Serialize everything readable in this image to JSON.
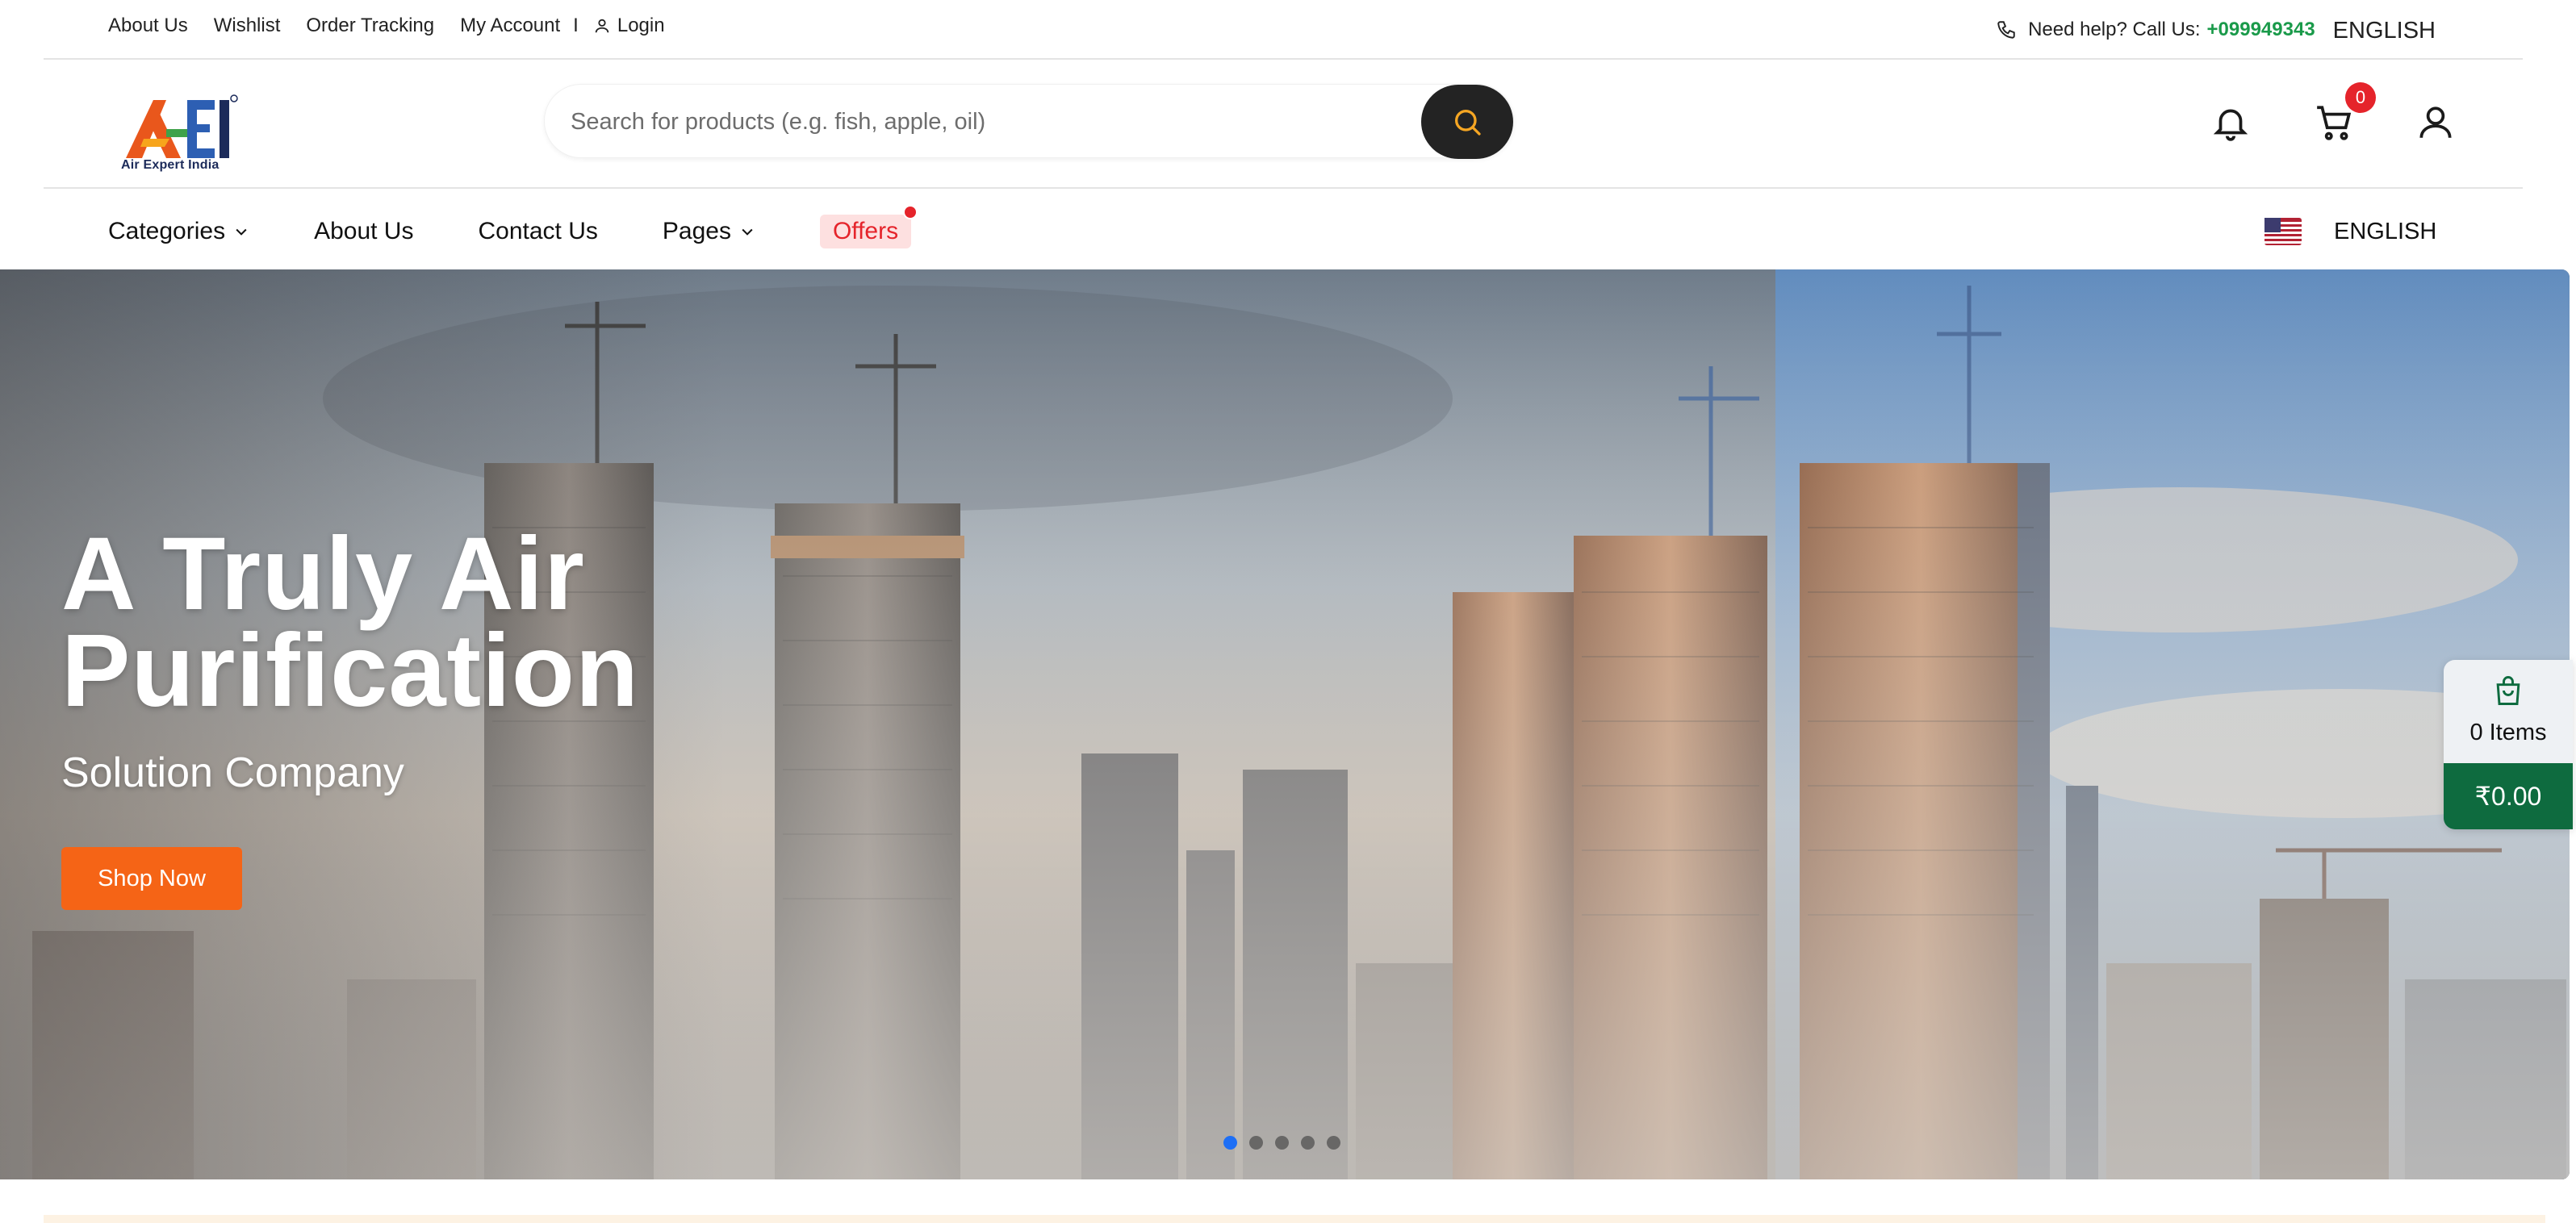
{
  "topbar": {
    "links": [
      "About Us",
      "Wishlist",
      "Order Tracking",
      "My Account"
    ],
    "separator": "I",
    "login": "Login",
    "help_text": "Need help? Call Us:",
    "phone": "+099949343",
    "language": "ENGLISH"
  },
  "header": {
    "logo_text": "Air Expert India",
    "search_placeholder": "Search for products (e.g. fish, apple, oil)",
    "cart_count": "0"
  },
  "nav": {
    "categories": "Categories",
    "about": "About Us",
    "contact": "Contact Us",
    "pages": "Pages",
    "offers": "Offers",
    "language": "ENGLISH"
  },
  "hero": {
    "title_line1": "A Truly Air",
    "title_line2": "Purification",
    "subtitle": "Solution Company",
    "cta": "Shop Now",
    "slides": 5,
    "active_slide": 1
  },
  "minicart": {
    "items": "0 Items",
    "total": "₹0.00"
  },
  "colors": {
    "accent": "#f56416",
    "phone": "#1a9a4a",
    "cart_total_bg": "#0e6b3f",
    "badge": "#e5242b",
    "active_dot": "#1e6ff5"
  },
  "icons": [
    "phone-icon",
    "user-icon",
    "search-icon",
    "bell-icon",
    "cart-icon",
    "chevron-down-icon",
    "us-flag-icon",
    "shopping-bag-icon"
  ]
}
